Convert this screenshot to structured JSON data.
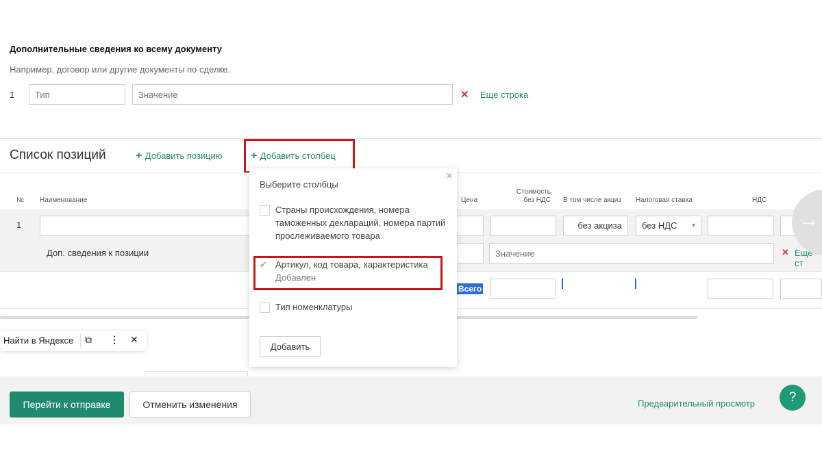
{
  "additional": {
    "title": "Дополнительные сведения ко всему документу",
    "hint": "Например, договор или другие документы по сделке.",
    "row_number": "1",
    "type_placeholder": "Тип",
    "value_placeholder": "Значение",
    "more_row_label": "Еще строка"
  },
  "positions": {
    "title": "Список позиций",
    "add_position_label": "Добавить позицию",
    "add_column_label": "Добавить столбец",
    "headers": {
      "num": "№",
      "name": "Наименование",
      "price": "Цена",
      "cost_line1": "Стоимость",
      "cost_line2": "без НДС",
      "excise": "В том числе акциз",
      "tax_rate": "Налоговая ставка",
      "vat": "НДС"
    },
    "row": {
      "number": "1",
      "excise_value": "без акциза",
      "tax_rate_value": "без НДС",
      "extra_info_label": "Доп. сведения к позиции",
      "value_placeholder": "Значение",
      "more_label": "Еще ст"
    },
    "total_label": "Всего"
  },
  "dropdown": {
    "title": "Выберите столбцы",
    "options": [
      {
        "line1": "Страны происхождения, номера",
        "line2": "таможенных деклараций, номера партий",
        "line3": "прослеживаемого товара"
      },
      {
        "line1": "Артикул, код товара, характеристика",
        "line2": "Добавлен"
      },
      {
        "line1": "Тип номенклатуры"
      }
    ],
    "add_button": "Добавить"
  },
  "yandex": {
    "label": "Найти в Яндексе"
  },
  "footer": {
    "submit_label": "Перейти к отправке",
    "cancel_label": "Отменить изменения",
    "preview_label": "Предварительный просмотр",
    "help_label": "?"
  },
  "colors": {
    "accent": "#1f8a6d",
    "highlight_frame": "#c8151b",
    "delete": "#d23a3a",
    "total_badge": "#2a6ed1"
  }
}
